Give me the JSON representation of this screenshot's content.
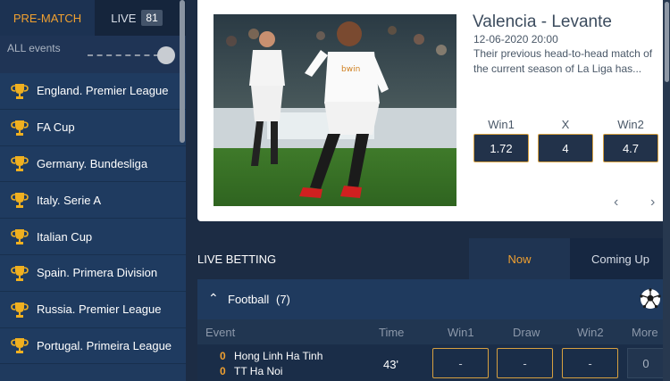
{
  "sidebar": {
    "tabs": {
      "prematch": "PRE-MATCH",
      "live": "LIVE",
      "live_count": "81"
    },
    "all_events": "ALL events",
    "leagues": [
      "England. Premier League",
      "FA Cup",
      "Germany. Bundesliga",
      "Italy. Serie A",
      "Italian Cup",
      "Spain. Primera Division",
      "Russia. Premier League",
      "Portugal. Primeira League"
    ]
  },
  "featured": {
    "title": "Valencia - Levante",
    "date": "12-06-2020 20:00",
    "description": "Their previous head-to-head match of the current season of La Liga has...",
    "odds": [
      {
        "label": "Win1",
        "value": "1.72"
      },
      {
        "label": "X",
        "value": "4"
      },
      {
        "label": "Win2",
        "value": "4.7"
      }
    ],
    "prev_arrow": "‹",
    "next_arrow": "›"
  },
  "live_betting": {
    "title": "LIVE BETTING",
    "tabs": {
      "now": "Now",
      "coming": "Coming Up"
    },
    "sport": {
      "name": "Football",
      "count": "(7)",
      "chevron": "⌃"
    },
    "columns": {
      "event": "Event",
      "time": "Time",
      "win1": "Win1",
      "draw": "Draw",
      "win2": "Win2",
      "more": "More"
    },
    "events": [
      {
        "score1": "0",
        "team1": "Hong Linh Ha Tinh",
        "score2": "0",
        "team2": "TT Ha Noi",
        "time": "43'",
        "win1": "-",
        "draw": "-",
        "win2": "-",
        "more": "0"
      }
    ]
  },
  "colors": {
    "accent": "#f0a030",
    "sidebar": "#1f3b60",
    "background": "#1c2c44",
    "odds_border": "#d6a040"
  },
  "icons": {
    "league": "trophy-icon",
    "sport": "soccer-ball-icon"
  }
}
